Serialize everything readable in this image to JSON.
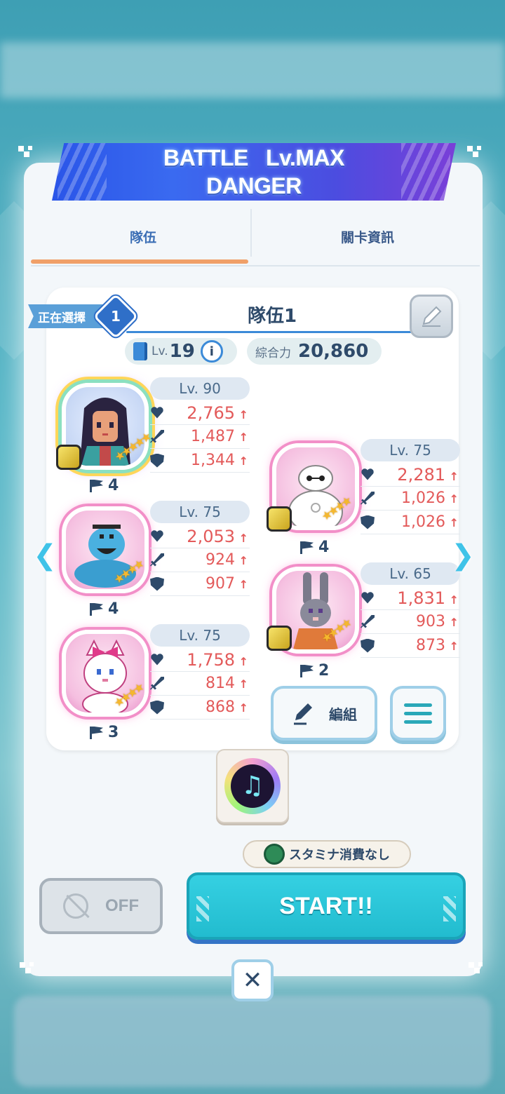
{
  "banner": {
    "line1": "BATTLE   Lv.MAX",
    "line2": "DANGER"
  },
  "tabs": [
    {
      "label": "隊伍",
      "active": true
    },
    {
      "label": "關卡資訊",
      "active": false
    }
  ],
  "team": {
    "selecting_label": "正在選擇",
    "number": "1",
    "name": "隊伍1",
    "book_level_prefix": "Lv.",
    "book_level": "19",
    "power_label": "綜合力",
    "power_value": "20,860"
  },
  "characters": [
    {
      "id": "mulan",
      "level": "Lv. 90",
      "hp": "2,765",
      "atk": "1,487",
      "def": "1,344",
      "flag": "4"
    },
    {
      "id": "baymax",
      "level": "Lv. 75",
      "hp": "2,281",
      "atk": "1,026",
      "def": "1,026",
      "flag": "4"
    },
    {
      "id": "genie",
      "level": "Lv. 75",
      "hp": "2,053",
      "atk": "924",
      "def": "907",
      "flag": "4"
    },
    {
      "id": "judy",
      "level": "Lv. 65",
      "hp": "1,831",
      "atk": "903",
      "def": "873",
      "flag": "2"
    },
    {
      "id": "marie",
      "level": "Lv. 75",
      "hp": "1,758",
      "atk": "814",
      "def": "868",
      "flag": "3"
    }
  ],
  "buttons": {
    "edit_label": "編組",
    "off_label": "OFF",
    "start_label": "START!!",
    "stamina_label": "スタミナ消費なし",
    "close_label": "✕"
  },
  "icons": {
    "left_arrow": "chevron-left-icon",
    "right_arrow": "chevron-right-icon",
    "edit": "pencil-icon",
    "list": "list-icon",
    "info": "info-icon",
    "book": "book-icon"
  },
  "colors": {
    "accent": "#22bccf",
    "stat_value": "#e35a5a",
    "tab_underline": "#f0a068"
  }
}
